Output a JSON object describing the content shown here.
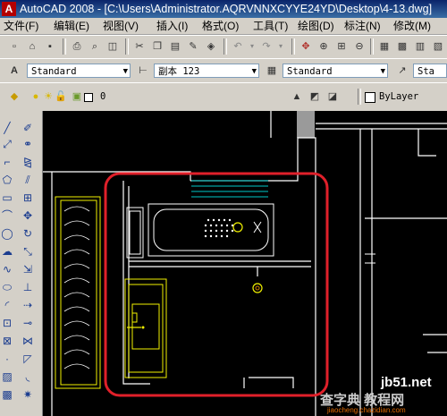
{
  "window": {
    "app_icon_letter": "A",
    "title": "AutoCAD 2008 - [C:\\Users\\Administrator.AQRVNNXCYYE24YD\\Desktop\\4-13.dwg]"
  },
  "menu": {
    "items": [
      "文件(F)",
      "编辑(E)",
      "视图(V)",
      "插入(I)",
      "格式(O)",
      "工具(T)",
      "绘图(D)",
      "标注(N)",
      "修改(M)"
    ]
  },
  "styles_toolbar": {
    "text_style": "Standard",
    "dim_style": "副本 123",
    "table_style": "Standard",
    "multileader_style": "Sta"
  },
  "layers_toolbar": {
    "current_layer": "0",
    "color": "ByLayer"
  },
  "watermark": {
    "site": "jb51.net",
    "brand": "查字典 教程网",
    "url": "jiaocheng.chazidian.com"
  },
  "colors": {
    "drawing_bg": "#000000",
    "wall": "#ffffff",
    "fixture": "#f2f200",
    "window": "#00c8c8",
    "highlight": "#e0202a"
  }
}
